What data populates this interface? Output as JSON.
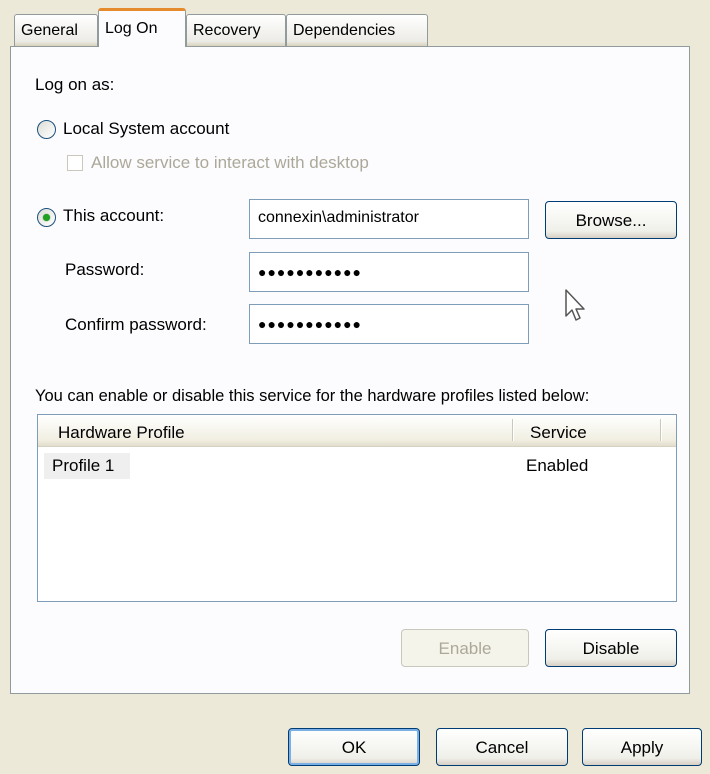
{
  "tabs": [
    "General",
    "Log On",
    "Recovery",
    "Dependencies"
  ],
  "active_tab": "Log On",
  "logon": {
    "heading": "Log on as:",
    "local_system_label": "Local System account",
    "allow_interact_label": "Allow service to interact with desktop",
    "this_account_label": "This account:",
    "account_value": "connexin\\administrator",
    "browse_label": "Browse...",
    "password_label": "Password:",
    "password_value": "●●●●●●●●●●●",
    "confirm_label": "Confirm password:",
    "confirm_value": "●●●●●●●●●●●",
    "selected_option": "This account"
  },
  "profiles": {
    "description": "You can enable or disable this service for the hardware profiles listed below:",
    "columns": [
      "Hardware Profile",
      "Service"
    ],
    "rows": [
      {
        "profile": "Profile 1",
        "service": "Enabled"
      }
    ],
    "enable_label": "Enable",
    "disable_label": "Disable"
  },
  "footer": {
    "ok_label": "OK",
    "cancel_label": "Cancel",
    "apply_label": "Apply"
  },
  "colors": {
    "window_bg": "#ece9d8",
    "tab_active_accent": "#e68b2c",
    "radio_dot": "#21a121",
    "textbox_border": "#7f9db9"
  },
  "icons": {
    "cursor": "arrow-cursor-icon"
  }
}
